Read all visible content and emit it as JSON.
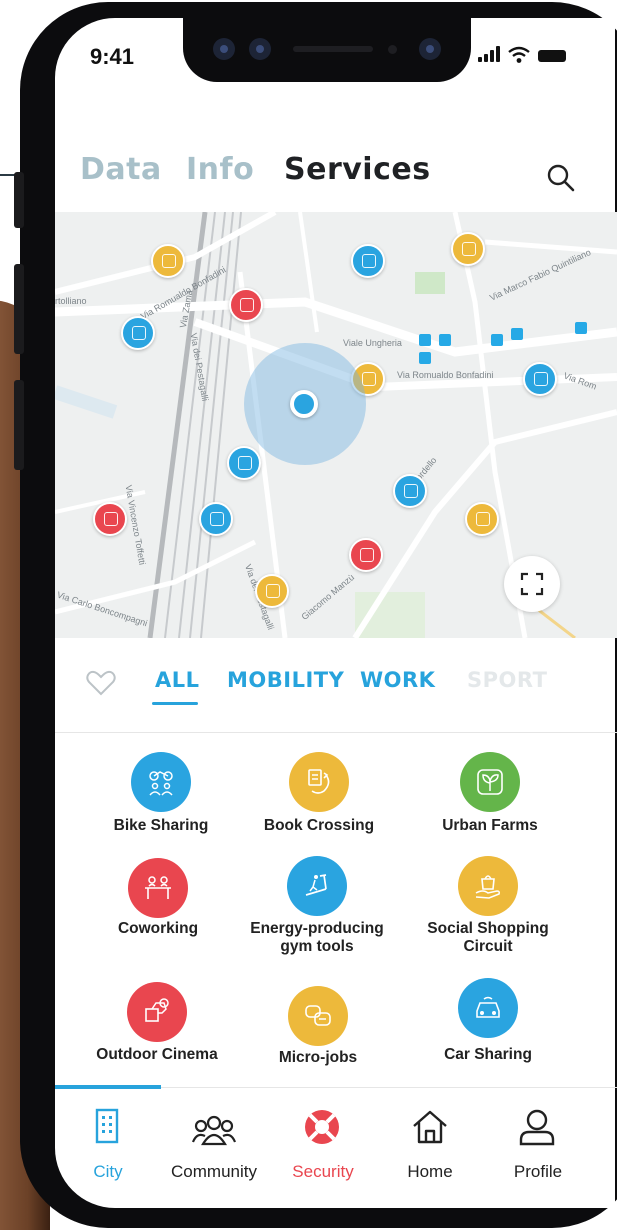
{
  "status_bar": {
    "time": "9:41"
  },
  "top_tabs": [
    {
      "label": "Data",
      "active": false
    },
    {
      "label": "Info",
      "active": false
    },
    {
      "label": "Services",
      "active": true
    }
  ],
  "map": {
    "street_labels": [
      "Via Romualdo Bonfadini",
      "Via Zama",
      "Via dei Pestagalli",
      "Viale Ungheria",
      "Via Romualdo Bonfadini",
      "Via Marco Fabio Quintiliano",
      "Via Vincenzo Toffetti",
      "Via Carlo Boncompagni",
      "Via dei Pestagalli",
      "Giacomo Manzù",
      "Via Sordello",
      "Via Rom",
      "rtolliano"
    ],
    "pin_colors": {
      "blue": "#2aa4e0",
      "red": "#e9464f",
      "yellow": "#edb93b",
      "green": "#64b54a"
    }
  },
  "filters": [
    {
      "label": "ALL",
      "active": true
    },
    {
      "label": "MOBILITY",
      "active": false
    },
    {
      "label": "WORK",
      "active": false
    },
    {
      "label": "SPORT",
      "active": false
    }
  ],
  "services": [
    {
      "label": "Bike Sharing",
      "color": "#2aa4e0",
      "icon": "bike-sharing-icon"
    },
    {
      "label": "Book Crossing",
      "color": "#edb93b",
      "icon": "book-crossing-icon"
    },
    {
      "label": "Urban Farms",
      "color": "#64b54a",
      "icon": "urban-farms-icon"
    },
    {
      "label": "Coworking",
      "color": "#e9464f",
      "icon": "coworking-icon"
    },
    {
      "label": "Energy-producing gym tools",
      "color": "#2aa4e0",
      "icon": "treadmill-icon"
    },
    {
      "label": "Social Shopping Circuit",
      "color": "#edb93b",
      "icon": "social-shopping-icon"
    },
    {
      "label": "Outdoor Cinema",
      "color": "#e9464f",
      "icon": "outdoor-cinema-icon"
    },
    {
      "label": "Micro-jobs",
      "color": "#edb93b",
      "icon": "micro-jobs-icon"
    },
    {
      "label": "Car Sharing",
      "color": "#2aa4e0",
      "icon": "car-sharing-icon"
    }
  ],
  "bottom_nav": [
    {
      "label": "City",
      "active": true,
      "color": "#27a3dc",
      "icon": "city-building-icon"
    },
    {
      "label": "Community",
      "active": false,
      "color": "#222222",
      "icon": "community-icon"
    },
    {
      "label": "Security",
      "active": false,
      "color": "#e9464f",
      "icon": "lifebuoy-icon"
    },
    {
      "label": "Home",
      "active": false,
      "color": "#222222",
      "icon": "home-icon"
    },
    {
      "label": "Profile",
      "active": false,
      "color": "#222222",
      "icon": "profile-icon"
    }
  ]
}
